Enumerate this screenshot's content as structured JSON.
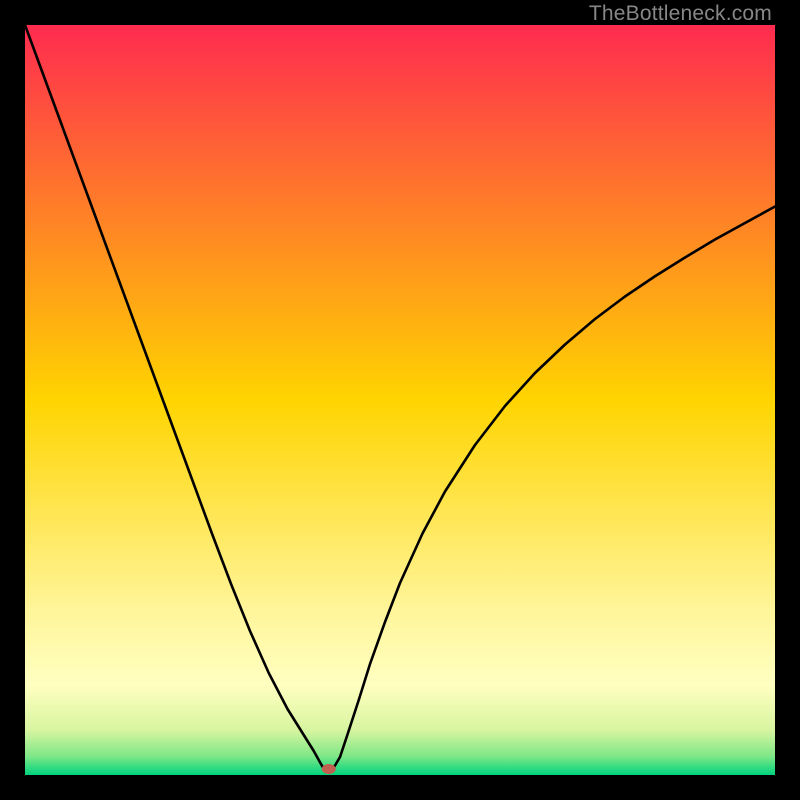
{
  "watermark": "TheBottleneck.com",
  "chart_data": {
    "type": "line",
    "title": "",
    "xlabel": "",
    "ylabel": "",
    "xlim": [
      0,
      100
    ],
    "ylim": [
      0,
      100
    ],
    "gradient_stops": [
      {
        "offset": 0.0,
        "color": "#ff2b4f"
      },
      {
        "offset": 0.5,
        "color": "#ffd400"
      },
      {
        "offset": 0.78,
        "color": "#fff59a"
      },
      {
        "offset": 0.88,
        "color": "#ffffc0"
      },
      {
        "offset": 0.94,
        "color": "#d8f5a0"
      },
      {
        "offset": 0.975,
        "color": "#7ee787"
      },
      {
        "offset": 1.0,
        "color": "#00d47e"
      }
    ],
    "marker": {
      "x": 40.5,
      "y": 0.8,
      "color": "#c06050"
    },
    "series": [
      {
        "name": "curve",
        "x": [
          0,
          2.5,
          5,
          7.5,
          10,
          12.5,
          15,
          17.5,
          20,
          22.5,
          25,
          27.5,
          30,
          32.5,
          35,
          37,
          38.5,
          39.5,
          40,
          40.5,
          41,
          42,
          43,
          44.5,
          46,
          48,
          50,
          53,
          56,
          60,
          64,
          68,
          72,
          76,
          80,
          84,
          88,
          92,
          96,
          100
        ],
        "values": [
          100,
          93.2,
          86.4,
          79.6,
          72.8,
          66.0,
          59.2,
          52.4,
          45.6,
          38.8,
          32.0,
          25.4,
          19.2,
          13.6,
          8.8,
          5.6,
          3.2,
          1.4,
          0.6,
          0.3,
          0.7,
          2.4,
          5.4,
          10.0,
          14.8,
          20.4,
          25.6,
          32.2,
          37.8,
          44.0,
          49.2,
          53.6,
          57.4,
          60.8,
          63.8,
          66.5,
          69.0,
          71.4,
          73.6,
          75.8
        ]
      }
    ]
  }
}
